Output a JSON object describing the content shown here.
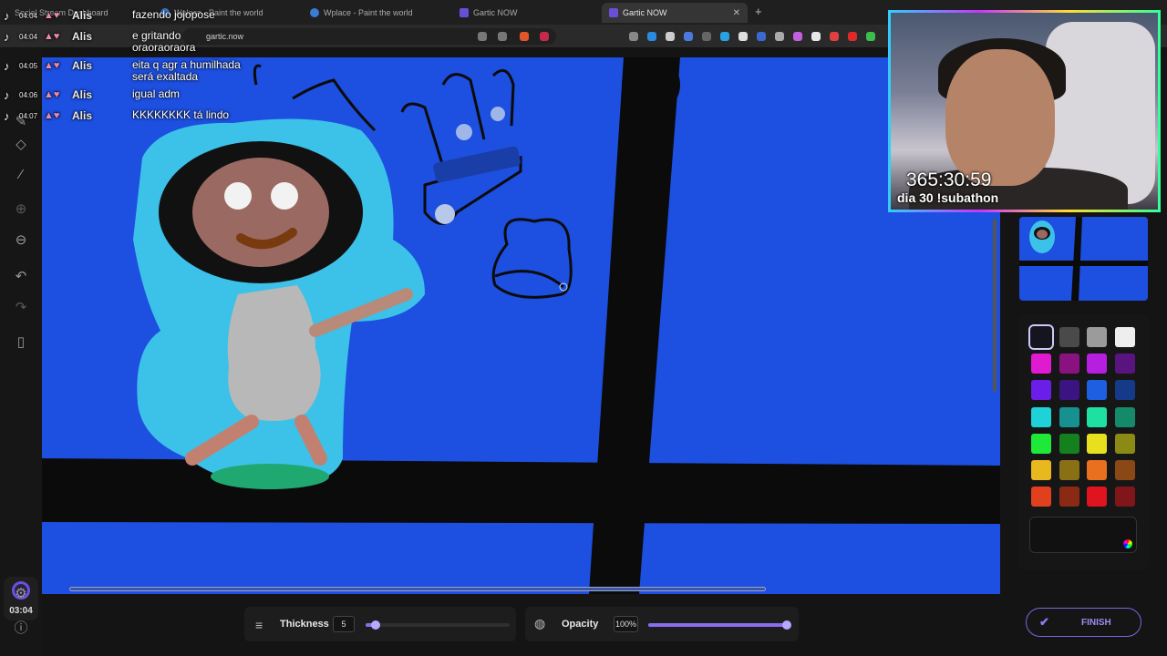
{
  "browser": {
    "tabs": [
      {
        "label": "Social Stream Dashboard",
        "active": false
      },
      {
        "label": "Wplace - Paint the world",
        "active": false
      },
      {
        "label": "Wplace - Paint the world",
        "active": false
      },
      {
        "label": "Gartic NOW",
        "active": false
      },
      {
        "label": "Gartic NOW",
        "active": true
      }
    ],
    "url": "gartic.now"
  },
  "chat": [
    {
      "time": "04:04",
      "user": "Alis",
      "text": "fazendo jojopose"
    },
    {
      "time": "04:04",
      "user": "Alis",
      "text": "e gritando oraoraoraora"
    },
    {
      "time": "04:05",
      "user": "Alis",
      "text": "eita q agr a humilhada será exaltada"
    },
    {
      "time": "04:06",
      "user": "Alis",
      "text": "igual adm"
    },
    {
      "time": "04:07",
      "user": "Alis",
      "text": "KKKKKKKK tá lindo"
    }
  ],
  "timer": "03:04",
  "webcam": {
    "counter": "365:30:59",
    "caption": "dia 30 !subathon"
  },
  "palette": [
    "#14151f",
    "#4a4a4a",
    "#9b9b9b",
    "#eeeeee",
    "#e01ad0",
    "#8a1280",
    "#b61ee0",
    "#5a1480",
    "#6a1ee8",
    "#3a1480",
    "#1d5fe0",
    "#153a8a",
    "#1ed2d8",
    "#179090",
    "#1ee0a0",
    "#158a6a",
    "#1ee838",
    "#15801e",
    "#e8e01e",
    "#8a8a15",
    "#e8b81e",
    "#8a7015",
    "#e8701e",
    "#8a4815",
    "#e0401e",
    "#8a2a15",
    "#e0141e",
    "#80151a"
  ],
  "controls": {
    "thickness_label": "Thickness",
    "thickness_value": "5",
    "thickness_fraction": 0.07,
    "opacity_label": "Opacity",
    "opacity_value": "100%",
    "opacity_fraction": 1.0,
    "finish_label": "FINISH"
  }
}
